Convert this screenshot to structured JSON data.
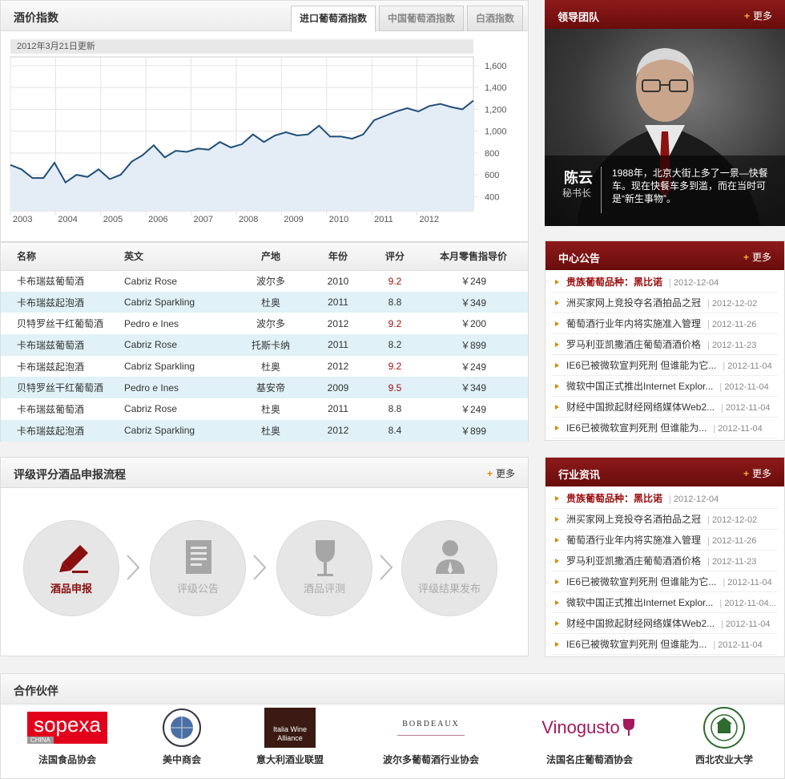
{
  "wine_index": {
    "title": "酒价指数",
    "tabs": [
      "进口葡萄酒指数",
      "中国葡萄酒指数",
      "白酒指数"
    ],
    "active_tab": 0,
    "updated": "2012年3月21日更新"
  },
  "chart_data": {
    "type": "area",
    "x_tick_labels": [
      "2003",
      "2004",
      "2005",
      "2006",
      "2007",
      "2008",
      "2009",
      "2010",
      "2011",
      "2012"
    ],
    "y_tick_labels": [
      "400",
      "600",
      "800",
      "1,000",
      "1,200",
      "1,400",
      "1,600"
    ],
    "ylim": [
      270,
      1680
    ],
    "grid": true,
    "values": [
      690,
      650,
      570,
      570,
      710,
      530,
      600,
      580,
      650,
      560,
      600,
      720,
      780,
      870,
      760,
      820,
      810,
      840,
      830,
      900,
      850,
      880,
      970,
      900,
      960,
      990,
      960,
      970,
      1050,
      950,
      950,
      930,
      970,
      1100,
      1140,
      1180,
      1210,
      1180,
      1230,
      1250,
      1220,
      1200,
      1280
    ],
    "color": "#1f4e79",
    "fill": "#e4edf6"
  },
  "price_table": {
    "headers": [
      "名称",
      "英文",
      "产地",
      "年份",
      "评分",
      "本月零售指导价"
    ],
    "rows": [
      {
        "name": "卡布瑞兹葡萄酒",
        "en": "Cabriz Rose",
        "origin": "波尔多",
        "year": "2010",
        "score": "9.2",
        "price": "￥249",
        "highlight": true
      },
      {
        "name": "卡布瑞兹起泡酒",
        "en": "Cabriz Sparkling",
        "origin": "杜奥",
        "year": "2011",
        "score": "8.8",
        "price": "￥349",
        "highlight": false
      },
      {
        "name": "贝特罗丝干红葡萄酒",
        "en": "Pedro e Ines",
        "origin": "波尔多",
        "year": "2012",
        "score": "9.2",
        "price": "￥200",
        "highlight": true
      },
      {
        "name": "卡布瑞兹葡萄酒",
        "en": "Cabriz Rose",
        "origin": "托斯卡纳",
        "year": "2011",
        "score": "8.2",
        "price": "￥899",
        "highlight": false
      },
      {
        "name": "卡布瑞兹起泡酒",
        "en": "Cabriz Sparkling",
        "origin": "杜奥",
        "year": "2012",
        "score": "9.2",
        "price": "￥249",
        "highlight": true
      },
      {
        "name": "贝特罗丝干红葡萄酒",
        "en": "Pedro e Ines",
        "origin": "基安帝",
        "year": "2009",
        "score": "9.5",
        "price": "￥349",
        "highlight": true
      },
      {
        "name": "卡布瑞兹葡萄酒",
        "en": "Cabriz Rose",
        "origin": "杜奥",
        "year": "2011",
        "score": "8.8",
        "price": "￥249",
        "highlight": false
      },
      {
        "name": "卡布瑞兹起泡酒",
        "en": "Cabriz Sparkling",
        "origin": "杜奥",
        "year": "2012",
        "score": "8.4",
        "price": "￥899",
        "highlight": false
      }
    ]
  },
  "process": {
    "title": "评级评分酒品申报流程",
    "more": "更多",
    "steps": [
      {
        "label": "酒品申报",
        "icon": "pen-icon",
        "active": true
      },
      {
        "label": "评级公告",
        "icon": "document-icon",
        "active": false
      },
      {
        "label": "酒品评测",
        "icon": "wine-glass-icon",
        "active": false
      },
      {
        "label": "评级结果发布",
        "icon": "person-icon",
        "active": false
      }
    ]
  },
  "leader": {
    "title": "领导团队",
    "more": "更多",
    "name": "陈云",
    "role": "秘书长",
    "quote": "1988年，北京大街上多了一景—快餐车。现在快餐车多到滥，而在当时可是“新生事物”。"
  },
  "notice": {
    "title": "中心公告",
    "more": "更多",
    "items": [
      {
        "title": "贵族葡萄品种：黑比诺",
        "date": "2012-12-04",
        "hot": true
      },
      {
        "title": "洲买家网上竞投夺名酒拍品之冠",
        "date": "2012-12-02",
        "hot": false
      },
      {
        "title": "葡萄酒行业年内将实施准入管理",
        "date": "2012-11-26",
        "hot": false
      },
      {
        "title": "罗马利亚凯撒酒庄葡萄酒酒价格",
        "date": "2012-11-23",
        "hot": false
      },
      {
        "title": "IE6已被微软宣判死刑 但谁能为它...",
        "date": "2012-11-04",
        "hot": false
      },
      {
        "title": "微软中国正式推出Internet Explor...",
        "date": "2012-11-04",
        "hot": false
      },
      {
        "title": "财经中国掀起财经网络媒体Web2...",
        "date": "2012-11-04",
        "hot": false
      },
      {
        "title": "IE6已被微软宣判死刑 但谁能为...",
        "date": "2012-11-04",
        "hot": false
      }
    ]
  },
  "industry": {
    "title": "行业资讯",
    "more": "更多",
    "items": [
      {
        "title": "贵族葡萄品种：黑比诺",
        "date": "2012-12-04",
        "hot": true
      },
      {
        "title": "洲买家网上竞投夺名酒拍品之冠",
        "date": "2012-12-02",
        "hot": false
      },
      {
        "title": "葡萄酒行业年内将实施准入管理",
        "date": "2012-11-26",
        "hot": false
      },
      {
        "title": "罗马利亚凯撒酒庄葡萄酒酒价格",
        "date": "2012-11-23",
        "hot": false
      },
      {
        "title": "IE6已被微软宣判死刑 但谁能为它...",
        "date": "2012-11-04",
        "hot": false
      },
      {
        "title": "微软中国正式推出Internet Explor...",
        "date": "2012-11-04...",
        "hot": false
      },
      {
        "title": "财经中国掀起财经网络媒体Web2...",
        "date": "2012-11-04",
        "hot": false
      },
      {
        "title": "IE6已被微软宣判死刑 但谁能为...",
        "date": "2012-11-04",
        "hot": false
      }
    ]
  },
  "partners": {
    "title": "合作伙伴",
    "items": [
      {
        "name": "法国食品协会",
        "logo_text": "sopexa",
        "logo_sub": "CHINA"
      },
      {
        "name": "美中商会",
        "logo_text": "",
        "logo_sub": ""
      },
      {
        "name": "意大利酒业联盟",
        "logo_text": "Italia Wine",
        "logo_sub": "Alliance"
      },
      {
        "name": "波尔多葡萄酒行业协会",
        "logo_text": "BORDEAUX",
        "logo_sub": ""
      },
      {
        "name": "法国名庄葡萄酒协会",
        "logo_text": "Vinogusto",
        "logo_sub": ""
      },
      {
        "name": "西北农业大学",
        "logo_text": "",
        "logo_sub": ""
      }
    ]
  }
}
